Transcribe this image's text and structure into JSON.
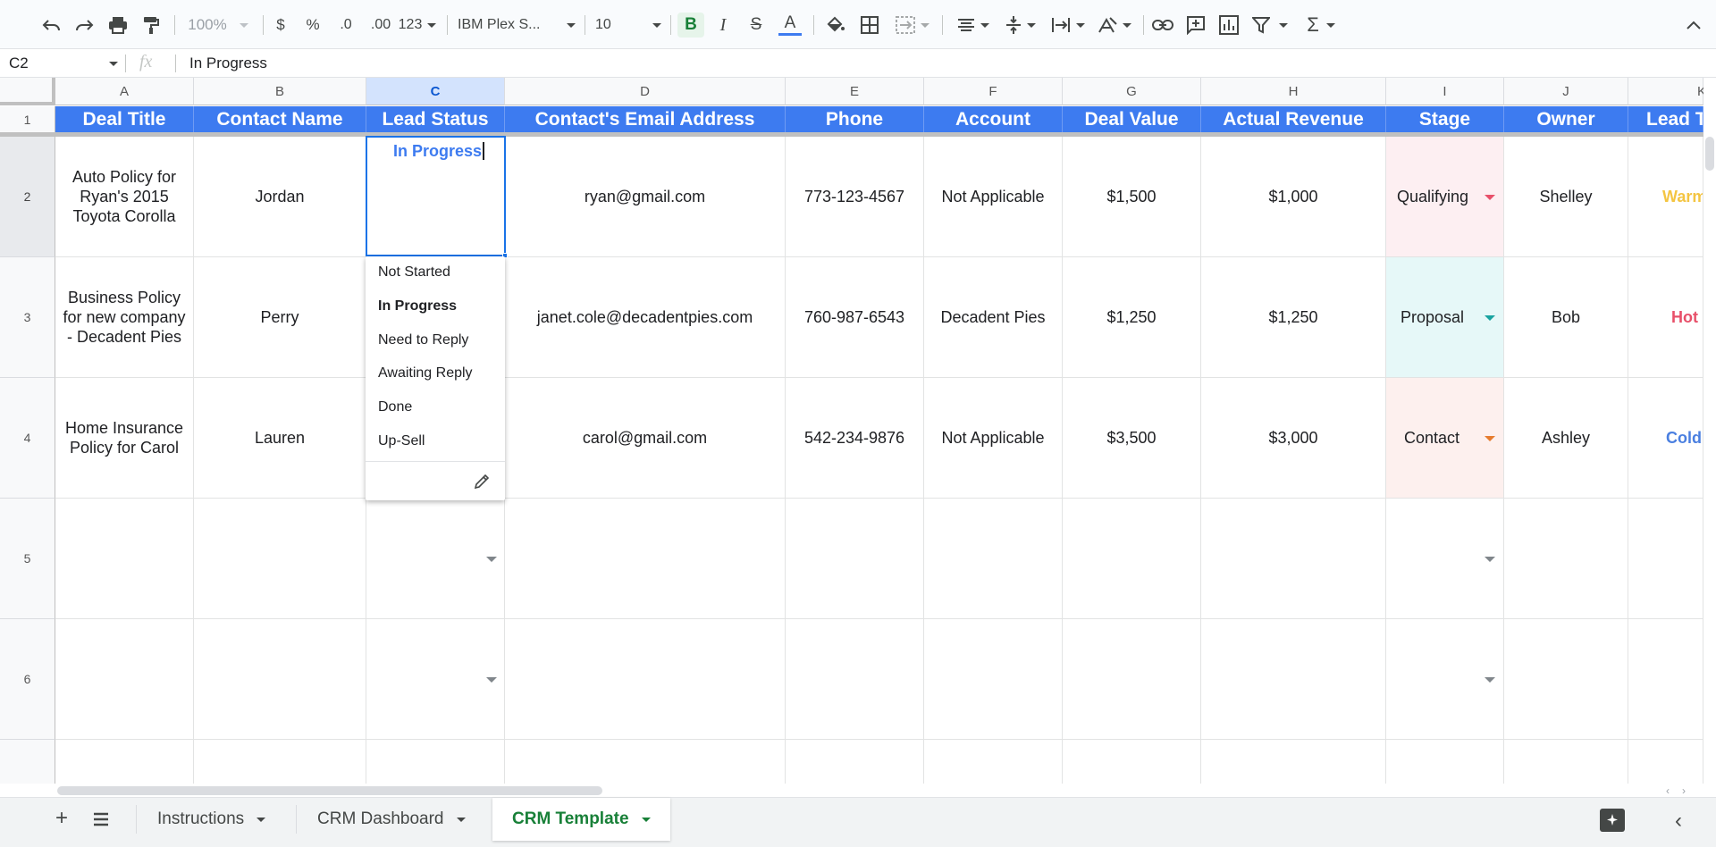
{
  "toolbar": {
    "zoom": "100%",
    "currency": "$",
    "percent": "%",
    "dec_decrease": ".0",
    "dec_increase": ".00",
    "number_format": "123",
    "font_family": "IBM Plex S...",
    "font_size": "10",
    "bold": "B",
    "italic": "I",
    "strike": "S",
    "text_color": "A",
    "sum": "Σ"
  },
  "formula_bar": {
    "cell_ref": "C2",
    "fx": "fx",
    "value": "In Progress"
  },
  "columns": [
    "A",
    "B",
    "C",
    "D",
    "E",
    "F",
    "G",
    "H",
    "I",
    "J",
    "K"
  ],
  "rows": [
    "1",
    "2",
    "3",
    "4",
    "5",
    "6"
  ],
  "header_row": [
    "Deal Title",
    "Contact Name",
    "Lead Status",
    "Contact's Email Address",
    "Phone",
    "Account",
    "Deal Value",
    "Actual Revenue",
    "Stage",
    "Owner",
    "Lead T"
  ],
  "data_rows": [
    {
      "deal": "Auto Policy for Ryan's 2015 Toyota Corolla",
      "contact": "Jordan",
      "status": "In Progress",
      "email": "ryan@gmail.com",
      "phone": "773-123-4567",
      "account": "Not Applicable",
      "deal_value": "$1,500",
      "revenue": "$1,000",
      "stage": "Qualifying",
      "owner": "Shelley",
      "lead_temp": "Warm"
    },
    {
      "deal": "Business Policy for new company - Decadent Pies",
      "contact": "Perry",
      "status": "",
      "email": "janet.cole@decadentpies.com",
      "phone": "760-987-6543",
      "account": "Decadent Pies",
      "deal_value": "$1,250",
      "revenue": "$1,250",
      "stage": "Proposal",
      "owner": "Bob",
      "lead_temp": "Hot"
    },
    {
      "deal": "Home Insurance Policy for Carol",
      "contact": "Lauren",
      "status": "",
      "email": "carol@gmail.com",
      "phone": "542-234-9876",
      "account": "Not Applicable",
      "deal_value": "$3,500",
      "revenue": "$3,000",
      "stage": "Contact",
      "owner": "Ashley",
      "lead_temp": "Cold"
    }
  ],
  "dropdown": {
    "options": [
      "Not Started",
      "In Progress",
      "Need to Reply",
      "Awaiting Reply",
      "Done",
      "Up-Sell"
    ],
    "selected": "In Progress"
  },
  "sheet_tabs": [
    {
      "label": "Instructions",
      "active": false
    },
    {
      "label": "CRM Dashboard",
      "active": false
    },
    {
      "label": "CRM Template",
      "active": true
    }
  ],
  "colors": {
    "header_blue": "#3d7bf0",
    "active_tab": "#188038",
    "stage_qualifying": "#fdeff2",
    "stage_proposal": "#e6f8f8",
    "stage_contact": "#fdf0ee",
    "warm": "#f4c542",
    "hot": "#e8506a",
    "cold": "#4a7fe0"
  }
}
